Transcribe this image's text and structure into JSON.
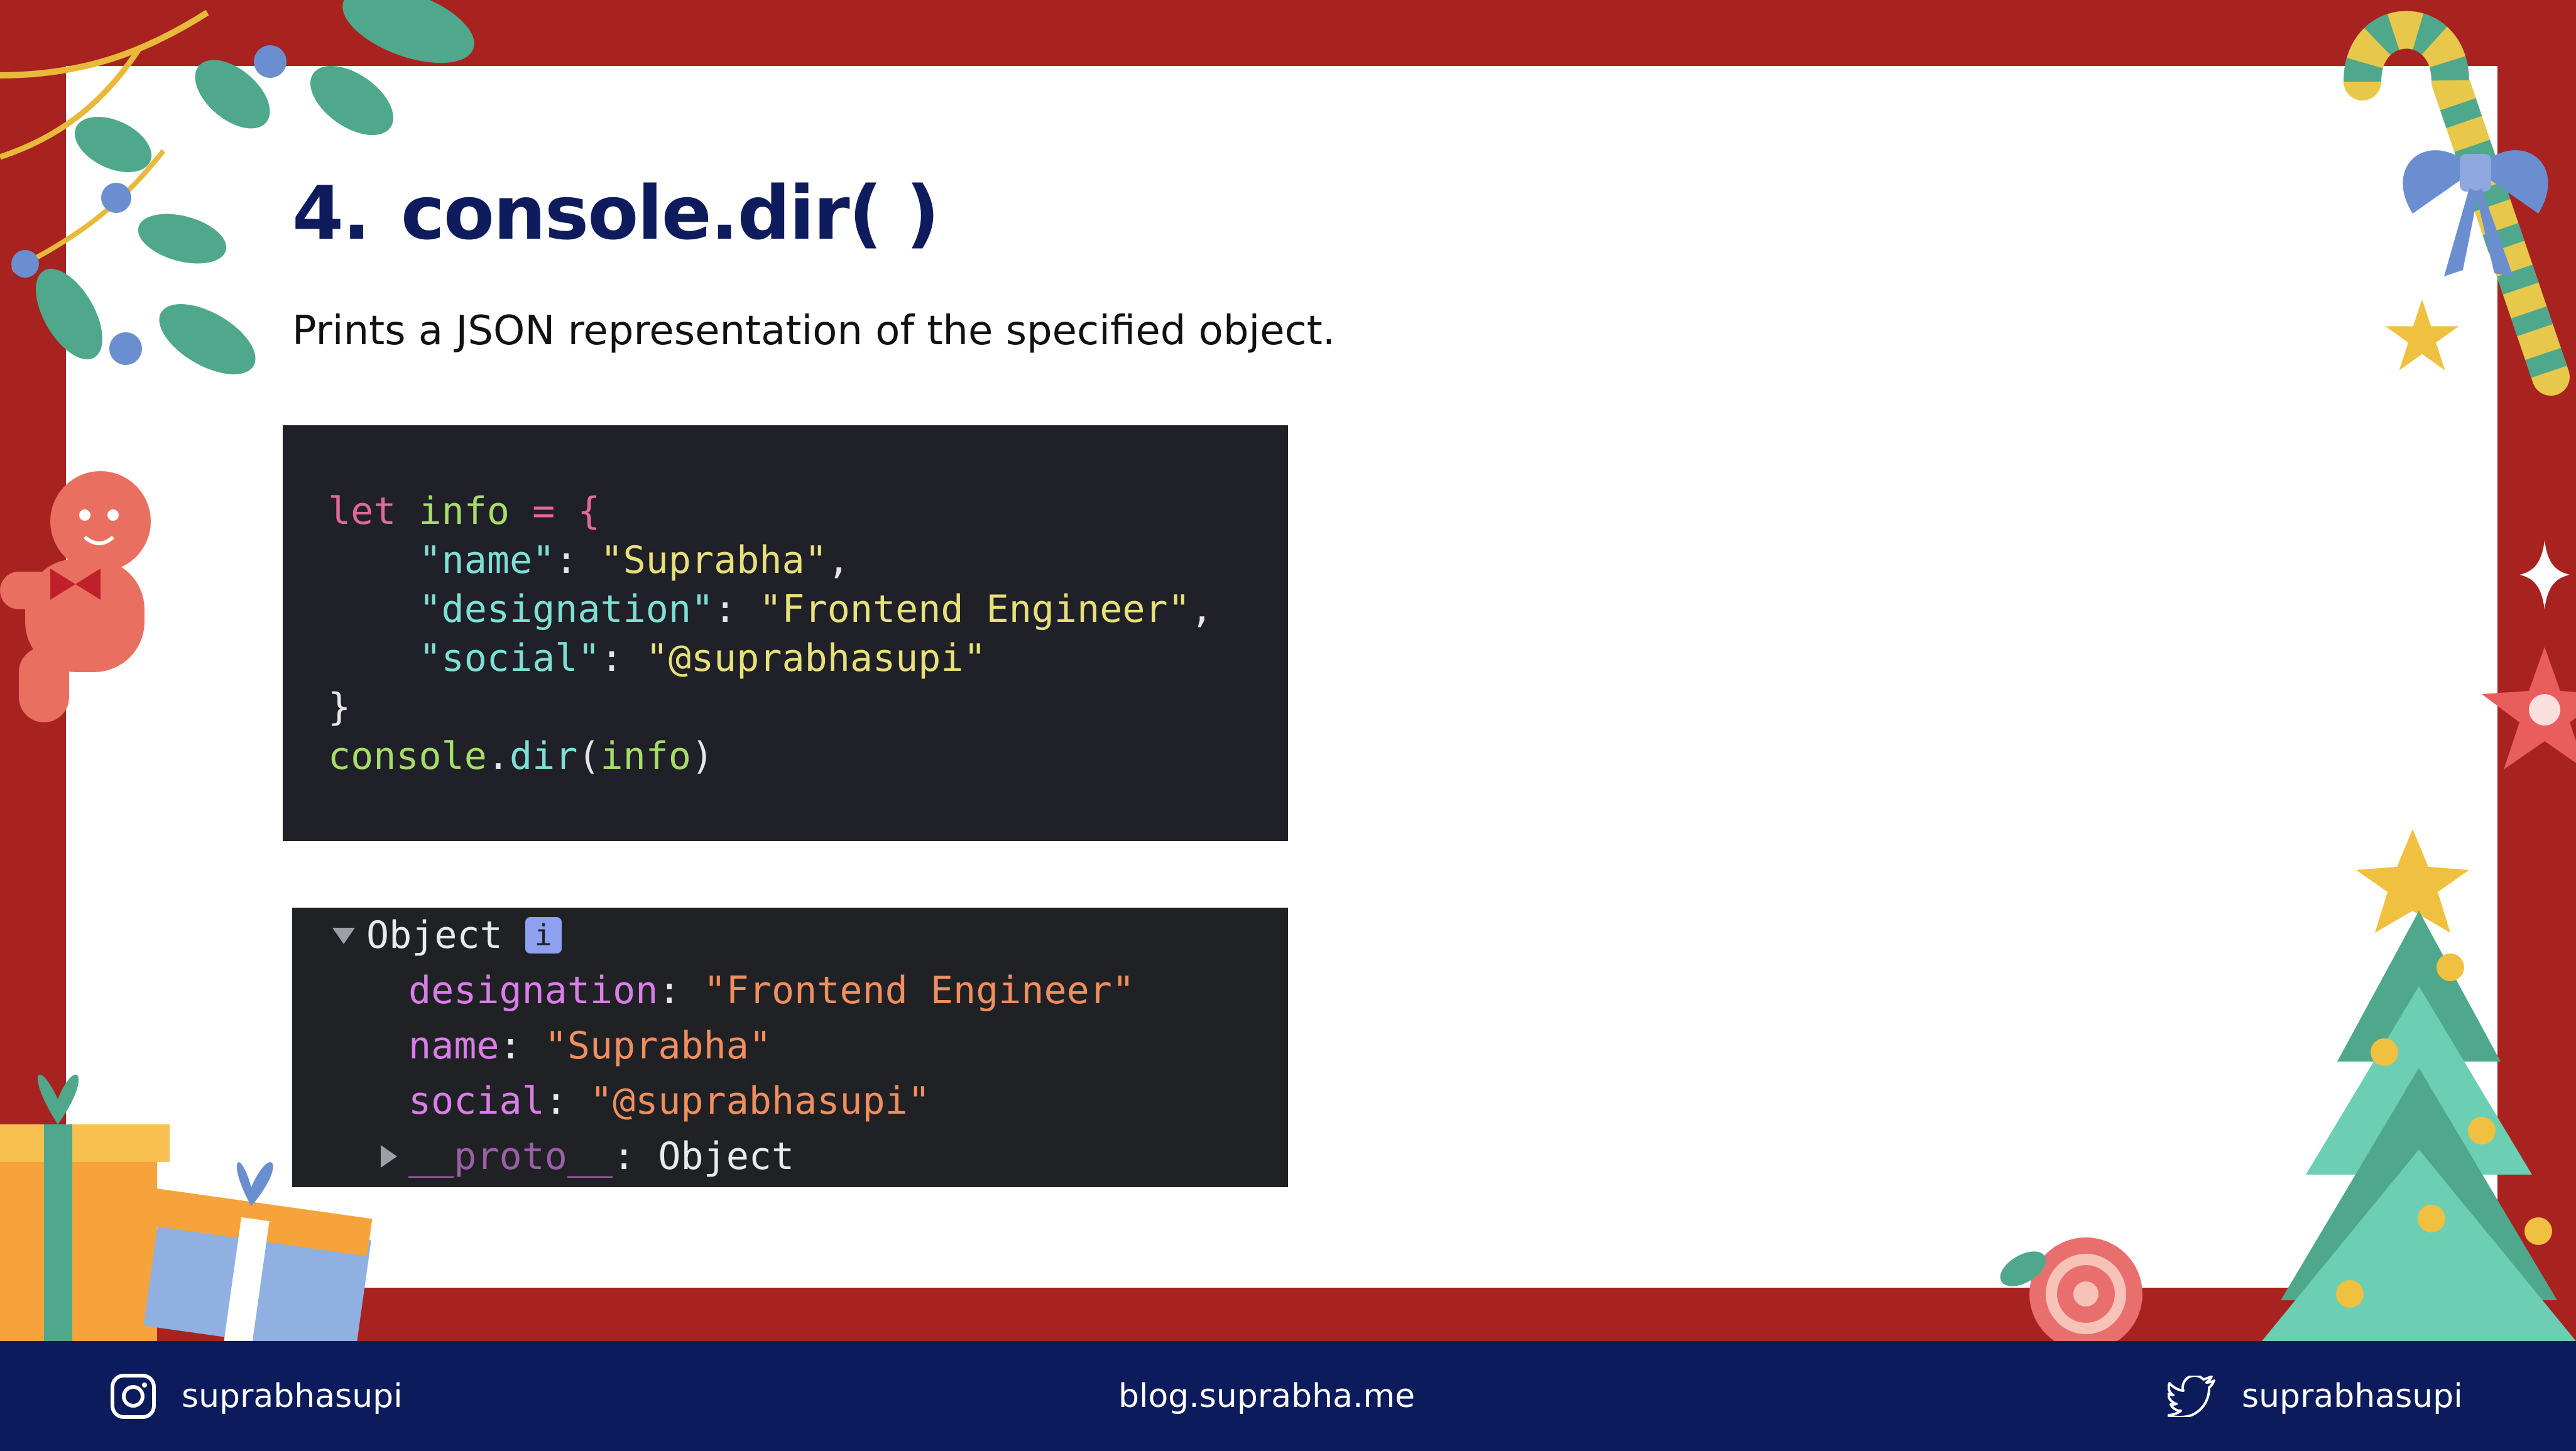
{
  "slide": {
    "number": "4.",
    "title": "console.dir( )",
    "subtitle": "Prints a JSON representation of the specified object."
  },
  "code": {
    "line1_kw": "let",
    "line1_var": "info",
    "line1_rest": " = {",
    "line2_key": "\"name\"",
    "line2_val": "\"Suprabha\"",
    "line3_key": "\"designation\"",
    "line3_val": "\"Frontend Engineer\"",
    "line4_key": "\"social\"",
    "line4_val": "\"@suprabhasupi\"",
    "line5": "}",
    "line6_obj": "console",
    "line6_fn": "dir",
    "line6_arg": "info"
  },
  "console_output": {
    "object_label": "Object",
    "info_badge": "i",
    "props": [
      {
        "key": "designation",
        "value": "\"Frontend Engineer\""
      },
      {
        "key": "name",
        "value": "\"Suprabha\""
      },
      {
        "key": "social",
        "value": "\"@suprabhasupi\""
      }
    ],
    "proto_key": "__proto__",
    "proto_value": "Object"
  },
  "footer": {
    "instagram_handle": "suprabhasupi",
    "blog_url": "blog.suprabha.me",
    "twitter_handle": "suprabhasupi"
  },
  "colors": {
    "frame": "#a82220",
    "footer": "#0b1b5c",
    "title": "#0e1c5e"
  },
  "icons": [
    "instagram-icon",
    "twitter-icon",
    "leaf-branch-icon",
    "candy-cane-icon",
    "ribbon-bow-icon",
    "star-icon",
    "gingerbread-man-icon",
    "snowflake-cookie-icon",
    "gift-box-icon",
    "christmas-tree-icon",
    "lollipop-icon",
    "sparkle-icon"
  ]
}
